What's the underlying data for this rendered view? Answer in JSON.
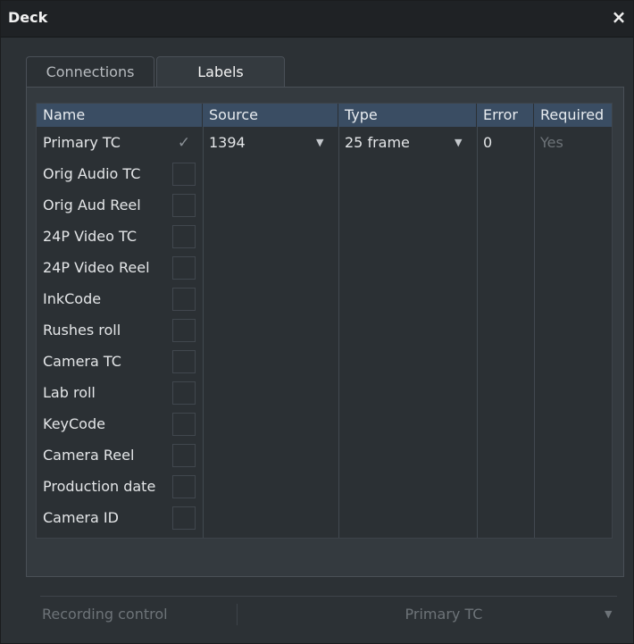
{
  "window": {
    "title": "Deck",
    "close_glyph": "×"
  },
  "tabs": [
    {
      "label": "Connections",
      "active": false
    },
    {
      "label": "Labels",
      "active": true
    }
  ],
  "table": {
    "columns": [
      "Name",
      "Source",
      "Type",
      "Error",
      "Required"
    ],
    "rows": [
      {
        "name": "Primary TC",
        "checked": true,
        "source": "1394",
        "type": "25 frame",
        "error": "0",
        "required": "Yes"
      },
      {
        "name": "Orig Audio TC",
        "checked": false
      },
      {
        "name": "Orig Aud Reel",
        "checked": false
      },
      {
        "name": "24P Video TC",
        "checked": false
      },
      {
        "name": "24P Video Reel",
        "checked": false
      },
      {
        "name": "InkCode",
        "checked": false
      },
      {
        "name": "Rushes roll",
        "checked": false
      },
      {
        "name": "Camera TC",
        "checked": false
      },
      {
        "name": "Lab roll",
        "checked": false
      },
      {
        "name": "KeyCode",
        "checked": false
      },
      {
        "name": "Camera Reel",
        "checked": false
      },
      {
        "name": "Production date",
        "checked": false
      },
      {
        "name": "Camera ID",
        "checked": false
      }
    ],
    "check_glyph": "✓",
    "dropdown_glyph": "▼"
  },
  "recording": {
    "label": "Recording control",
    "value": "Primary TC",
    "dropdown_glyph": "▼"
  },
  "colors": {
    "header_bg": "#3a4d63",
    "panel_bg": "#343a3f",
    "grid_bg": "#2b3034",
    "title_bg": "#1f2225"
  }
}
